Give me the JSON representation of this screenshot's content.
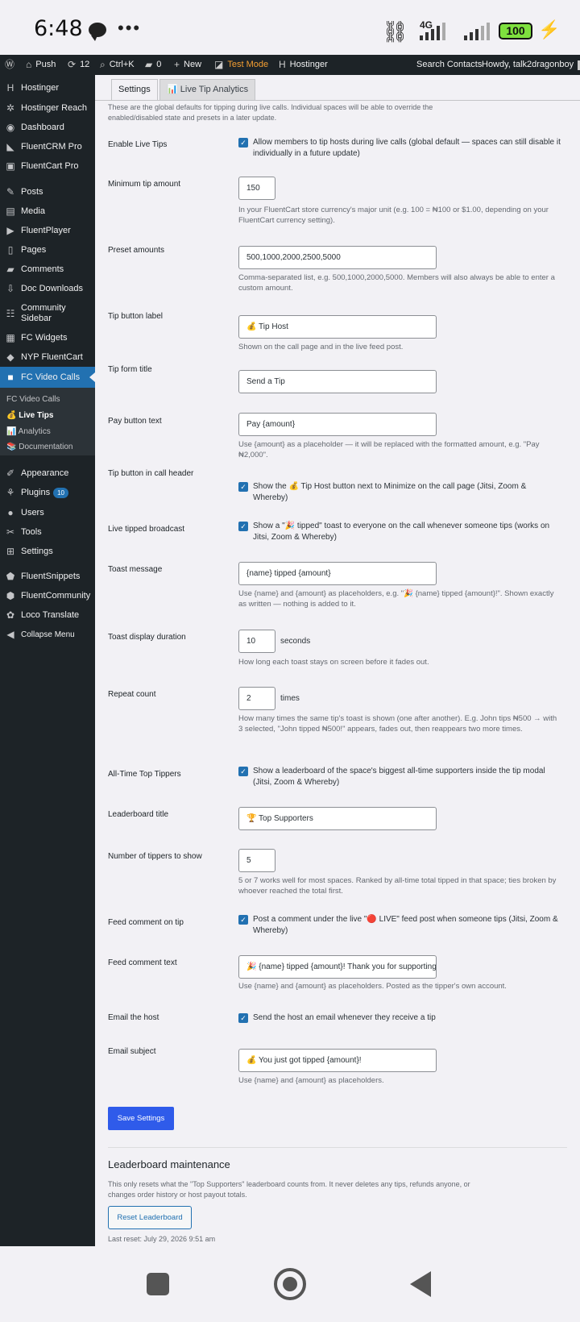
{
  "status_bar": {
    "time": "6:48",
    "dots": "•••",
    "net": "4G",
    "battery": "100",
    "bolt": "⚡"
  },
  "admin_bar": {
    "wp_icon": "wordpress-icon",
    "push": "Push",
    "updates": "12",
    "search_shortcut": "Ctrl+K",
    "comments": "0",
    "new": "New",
    "test_mode": "Test Mode",
    "hostinger": "Hostinger",
    "search_contacts": "Search Contacts",
    "howdy": "Howdy, talk2dragonboy"
  },
  "sidebar": {
    "items": [
      {
        "label": "Hostinger",
        "icon": "H"
      },
      {
        "label": "Hostinger Reach",
        "icon": "✲"
      },
      {
        "label": "Dashboard",
        "icon": "◉"
      },
      {
        "label": "FluentCRM Pro",
        "icon": "◣"
      },
      {
        "label": "FluentCart Pro",
        "icon": "▣"
      },
      {
        "label": "Posts",
        "icon": "✎"
      },
      {
        "label": "Media",
        "icon": "▤"
      },
      {
        "label": "FluentPlayer",
        "icon": "▶"
      },
      {
        "label": "Pages",
        "icon": "▯"
      },
      {
        "label": "Comments",
        "icon": "▰"
      },
      {
        "label": "Doc Downloads",
        "icon": "⇩"
      },
      {
        "label": "Community Sidebar",
        "icon": "☷"
      },
      {
        "label": "FC Widgets",
        "icon": "▦"
      },
      {
        "label": "NYP FluentCart",
        "icon": "◆"
      },
      {
        "label": "FC Video Calls",
        "icon": "■"
      },
      {
        "label": "Appearance",
        "icon": "✐"
      },
      {
        "label": "Plugins",
        "icon": "⚘",
        "badge": "10"
      },
      {
        "label": "Users",
        "icon": "●"
      },
      {
        "label": "Tools",
        "icon": "✂"
      },
      {
        "label": "Settings",
        "icon": "⊞"
      },
      {
        "label": "FluentSnippets",
        "icon": "⬟"
      },
      {
        "label": "FluentCommunity",
        "icon": "⬢"
      },
      {
        "label": "Loco Translate",
        "icon": "✿"
      },
      {
        "label": "Collapse Menu",
        "icon": "◀"
      }
    ],
    "sub_items": [
      "FC Video Calls",
      "💰 Live Tips",
      "📊 Analytics",
      "📚 Documentation"
    ]
  },
  "tabs": {
    "settings": "Settings",
    "analytics": "📊 Live Tip Analytics"
  },
  "intro": "These are the global defaults for tipping during live calls. Individual spaces will be able to override the enabled/disabled state and presets in a later update.",
  "fields": {
    "enable_live_tips": {
      "label": "Enable Live Tips",
      "check": "Allow members to tip hosts during live calls (global default — spaces can still disable it individually in a future update)"
    },
    "min_tip": {
      "label": "Minimum tip amount",
      "value": "150",
      "desc": "In your FluentCart store currency's major unit (e.g. 100 = ₦100 or $1.00, depending on your FluentCart currency setting)."
    },
    "preset": {
      "label": "Preset amounts",
      "value": "500,1000,2000,2500,5000",
      "desc": "Comma-separated list, e.g. 500,1000,2000,5000. Members will also always be able to enter a custom amount."
    },
    "tip_button_label": {
      "label": "Tip button label",
      "value": "💰 Tip Host",
      "desc": "Shown on the call page and in the live feed post."
    },
    "tip_form_title": {
      "label": "Tip form title",
      "value": "Send a Tip"
    },
    "pay_button": {
      "label": "Pay button text",
      "value": "Pay {amount}",
      "desc": "Use {amount} as a placeholder — it will be replaced with the formatted amount, e.g. \"Pay ₦2,000\"."
    },
    "header_button": {
      "label": "Tip button in call header",
      "check": "Show the 💰 Tip Host button next to Minimize on the call page (Jitsi, Zoom & Whereby)"
    },
    "broadcast": {
      "label": "Live tipped broadcast",
      "check": "Show a \"🎉 tipped\" toast to everyone on the call whenever someone tips (works on Jitsi, Zoom & Whereby)"
    },
    "toast_message": {
      "label": "Toast message",
      "value": "{name} tipped {amount}",
      "desc": "Use {name} and {amount} as placeholders, e.g. \"🎉 {name} tipped {amount}!\". Shown exactly as written — nothing is added to it."
    },
    "toast_duration": {
      "label": "Toast display duration",
      "value": "10",
      "unit": "seconds",
      "desc": "How long each toast stays on screen before it fades out."
    },
    "repeat": {
      "label": "Repeat count",
      "value": "2",
      "unit": "times",
      "desc": "How many times the same tip's toast is shown (one after another). E.g. John tips ₦500 → with 3 selected, \"John tipped ₦500!\" appears, fades out, then reappears two more times."
    },
    "top_tippers": {
      "label": "All-Time Top Tippers",
      "check": "Show a leaderboard of the space's biggest all-time supporters inside the tip modal (Jitsi, Zoom & Whereby)"
    },
    "leaderboard_title": {
      "label": "Leaderboard title",
      "value": "🏆 Top Supporters"
    },
    "num_tippers": {
      "label": "Number of tippers to show",
      "value": "5",
      "desc": "5 or 7 works well for most spaces. Ranked by all-time total tipped in that space; ties broken by whoever reached the total first."
    },
    "feed_comment": {
      "label": "Feed comment on tip",
      "check": "Post a comment under the live \"🔴 LIVE\" feed post when someone tips (Jitsi, Zoom & Whereby)"
    },
    "feed_comment_text": {
      "label": "Feed comment text",
      "value": "🎉 {name} tipped {amount}! Thank you for supporting",
      "desc": "Use {name} and {amount} as placeholders. Posted as the tipper's own account."
    },
    "email_host": {
      "label": "Email the host",
      "check": "Send the host an email whenever they receive a tip"
    },
    "email_subject": {
      "label": "Email subject",
      "value": "💰 You just got tipped {amount}!",
      "desc": "Use {name} and {amount} as placeholders."
    }
  },
  "save_button": "Save Settings",
  "maintenance": {
    "title": "Leaderboard maintenance",
    "desc": "This only resets what the \"Top Supporters\" leaderboard counts from. It never deletes any tips, refunds anyone, or changes order history or host payout totals.",
    "button": "Reset Leaderboard",
    "last_reset": "Last reset: July 29, 2026 9:51 am"
  },
  "colors": {
    "admin_bg": "#1d2327",
    "accent": "#2271b1",
    "primary_btn": "#2f5bea",
    "test_mode": "#f59f32"
  }
}
